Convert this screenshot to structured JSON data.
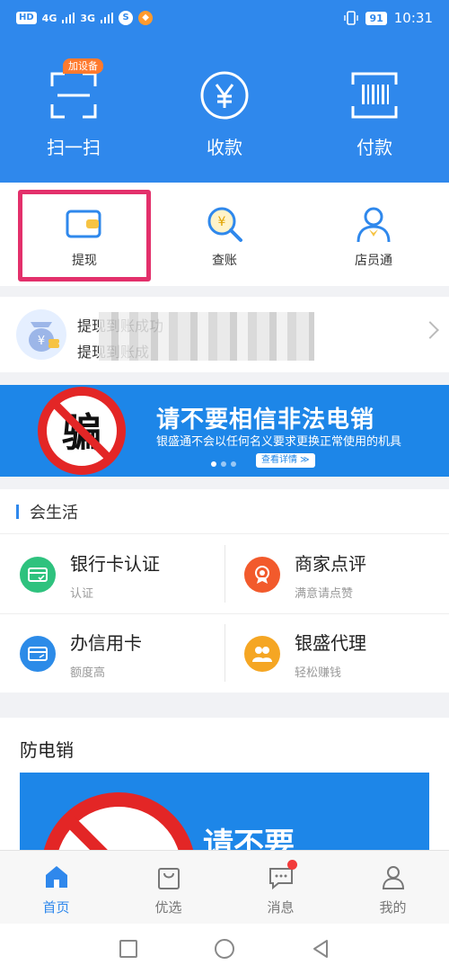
{
  "status_bar": {
    "carrier_hd": "HD",
    "net1": "4G",
    "net2": "3G",
    "battery": "91",
    "time": "10:31"
  },
  "hero": {
    "items": [
      {
        "label": "扫一扫",
        "icon": "scan-icon"
      },
      {
        "label": "收款",
        "icon": "yen-circle-icon"
      },
      {
        "label": "付款",
        "icon": "barcode-icon"
      }
    ],
    "badge": "加设备"
  },
  "quick": {
    "items": [
      {
        "label": "提现",
        "icon": "wallet-icon"
      },
      {
        "label": "查账",
        "icon": "search-yen-icon"
      },
      {
        "label": "店员通",
        "icon": "staff-icon"
      }
    ]
  },
  "notice": {
    "line1": "提现到账成功",
    "line2": "提现到账成"
  },
  "banner": {
    "title": "请不要相信非法电销",
    "subtitle": "银盛通不会以任何名义要求更换正常使用的机具",
    "button": "查看详情 ≫",
    "stamp_char": "骗"
  },
  "life": {
    "heading": "会生活",
    "cells": [
      {
        "title": "银行卡认证",
        "sub": "认证",
        "color": "#2ec27e",
        "icon": "bank-card-icon"
      },
      {
        "title": "商家点评",
        "sub": "满意请点赞",
        "color": "#f25a2c",
        "icon": "medal-icon"
      },
      {
        "title": "办信用卡",
        "sub": "额度高",
        "color": "#2c8be8",
        "icon": "credit-card-icon"
      },
      {
        "title": "银盛代理",
        "sub": "轻松赚钱",
        "color": "#f5a623",
        "icon": "agents-icon"
      }
    ]
  },
  "anti_fraud": {
    "title": "防电销",
    "image_text": "请不要"
  },
  "tabbar": {
    "tabs": [
      {
        "label": "首页",
        "icon": "home-icon",
        "active": true
      },
      {
        "label": "优选",
        "icon": "bag-icon",
        "active": false
      },
      {
        "label": "消息",
        "icon": "message-icon",
        "active": false
      },
      {
        "label": "我的",
        "icon": "profile-icon",
        "active": false
      }
    ]
  },
  "colors": {
    "primary": "#2f88ec",
    "highlight": "#e3306b"
  }
}
